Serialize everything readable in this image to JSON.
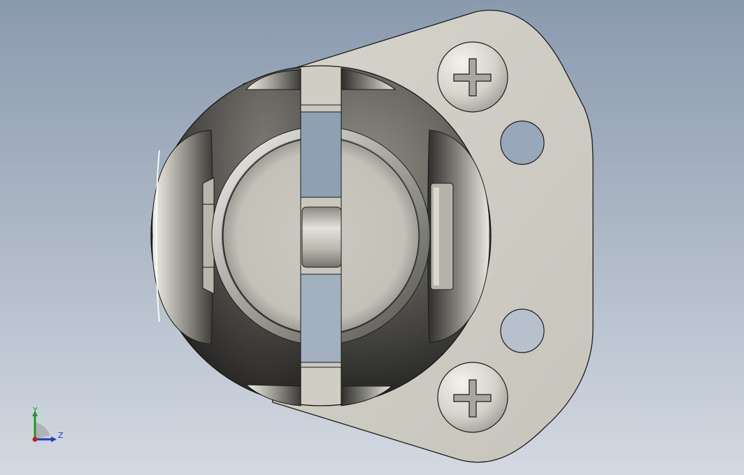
{
  "viewport": {
    "background_top": "#8a9aae",
    "background_bottom": "#d3d9e2"
  },
  "model": {
    "description_icon": "ball-joint-flange-part",
    "plate_color": "#cfcdc4",
    "sphere_color": "#5e5d58",
    "screw_head_icon": "phillips-screw-icon",
    "mount_holes": 2,
    "screws": 2
  },
  "triad": {
    "y_label": "Y",
    "z_label": "Z",
    "y_color": "#1a9a1a",
    "z_color": "#1d3ec2",
    "x_color": "#d01818"
  }
}
